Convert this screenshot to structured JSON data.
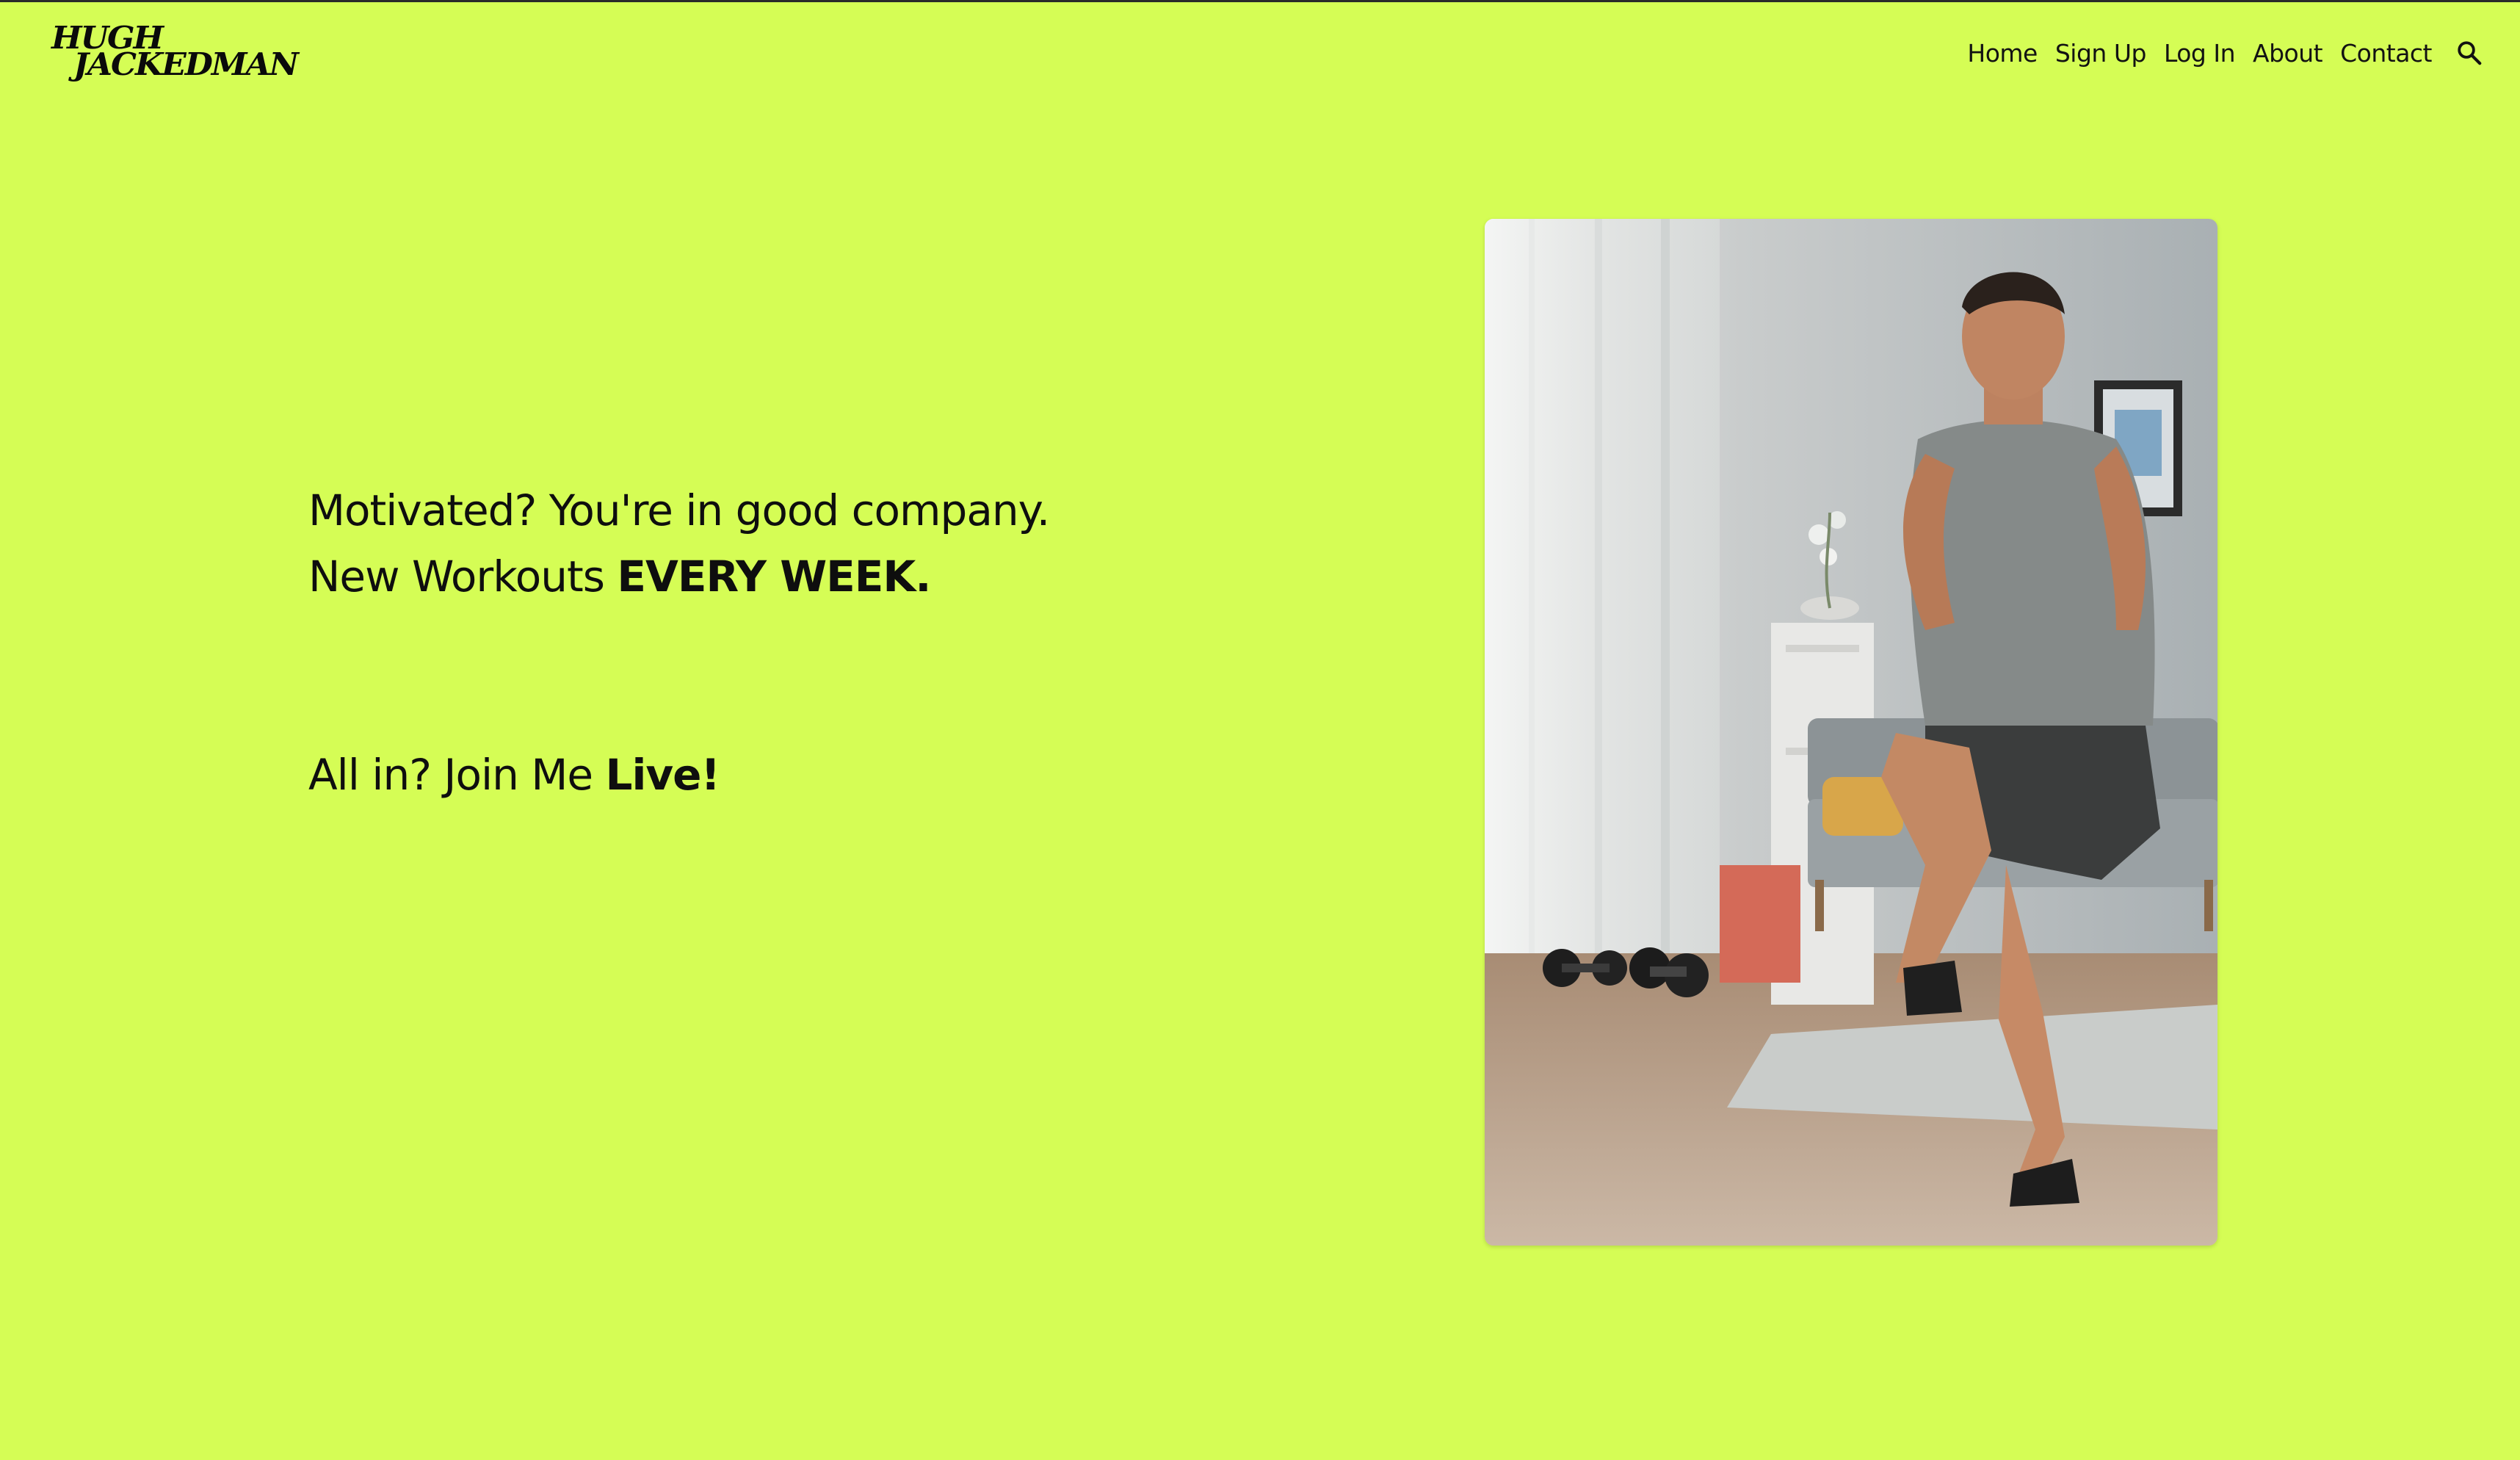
{
  "brand": {
    "line1": "HUGH",
    "line2": "JACKEDMAN"
  },
  "nav": {
    "items": [
      {
        "label": "Home"
      },
      {
        "label": "Sign Up"
      },
      {
        "label": "Log In"
      },
      {
        "label": "About"
      },
      {
        "label": "Contact"
      }
    ],
    "search_icon": "search-icon"
  },
  "hero": {
    "line1": "Motivated? You're in good company.",
    "line2_prefix": "New Workouts ",
    "line2_bold": "EVERY WEEK.",
    "line3_prefix": "All in? Join Me ",
    "line3_bold": "Live!"
  },
  "colors": {
    "background": "#d5fd55",
    "text": "#0e0e0e"
  }
}
